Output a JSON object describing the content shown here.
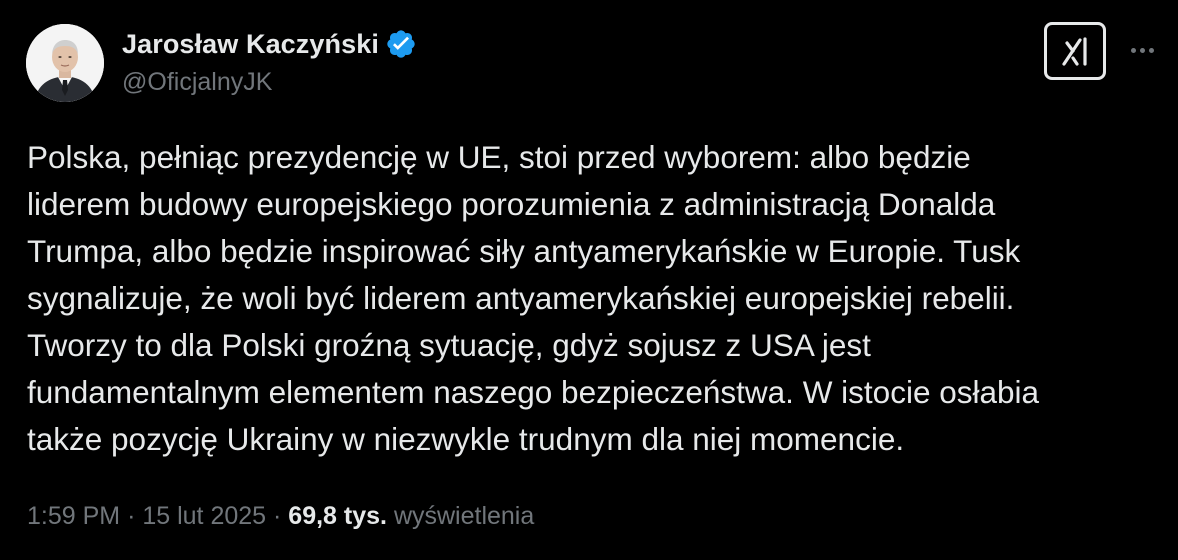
{
  "author": {
    "display_name": "Jarosław Kaczyński",
    "handle": "@OficjalnyJK",
    "verified_color": "#1d9bf0"
  },
  "actions": {
    "grok_icon": "grok-icon",
    "more_icon": "more-icon"
  },
  "tweet": {
    "lines": [
      "Polska, pełniąc prezydencję w UE, stoi przed wyborem: albo będzie",
      "liderem budowy europejskiego porozumienia z administracją Donalda",
      "Trumpa, albo będzie inspirować siły antyamerykańskie w Europie. Tusk",
      "sygnalizuje, że woli być liderem antyamerykańskiej europejskiej rebelii.",
      "Tworzy to dla Polski groźną sytuację, gdyż sojusz z USA jest",
      "fundamentalnym elementem naszego bezpieczeństwa. W istocie osłabia",
      "także pozycję Ukrainy w niezwykle trudnym dla niej momencie."
    ]
  },
  "meta": {
    "time": "1:59 PM",
    "separator": "·",
    "date": "15 lut 2025",
    "views_count": "69,8 tys.",
    "views_label": "wyświetlenia"
  },
  "colors": {
    "background": "#000000",
    "text_primary": "#e7e9ea",
    "text_secondary": "#71767b"
  }
}
